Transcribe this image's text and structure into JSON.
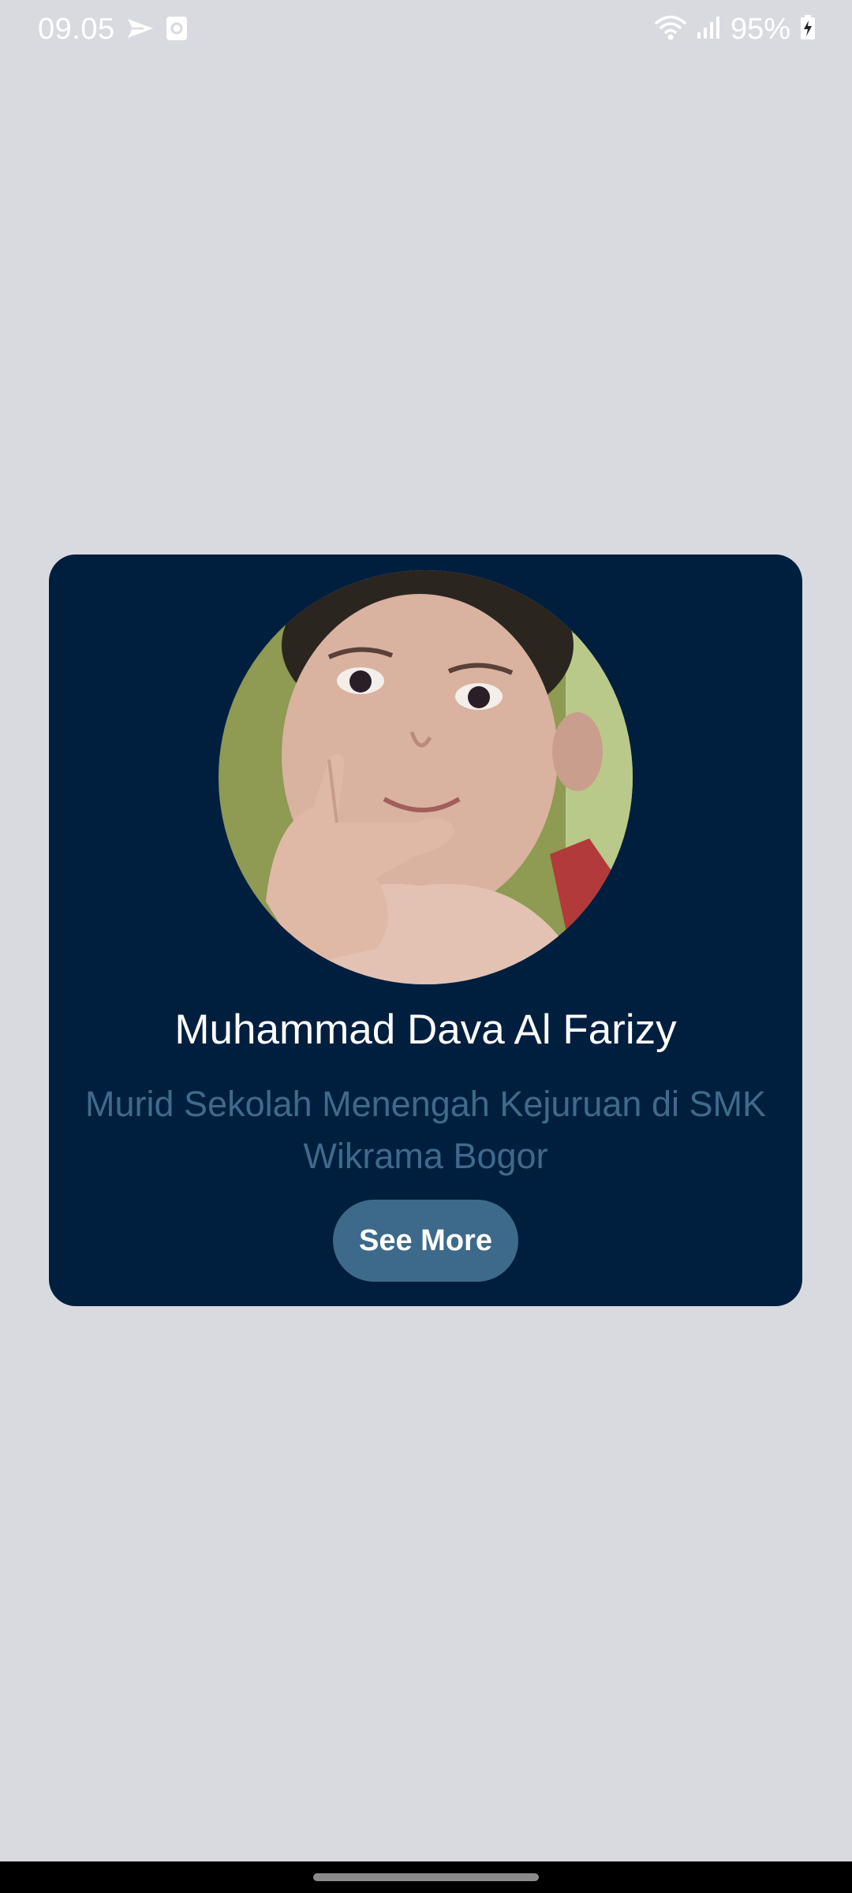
{
  "status_bar": {
    "time": "09.05",
    "battery": "95%",
    "icons": [
      "send-icon",
      "screen-record-icon",
      "wifi-icon",
      "signal-icon",
      "battery-charging-icon"
    ]
  },
  "profile": {
    "name": "Muhammad Dava Al Farizy",
    "description": "Murid Sekolah Menengah Kejuruan di SMK Wikrama Bogor",
    "button_label": "See More"
  },
  "colors": {
    "background": "#d9dae0",
    "card": "#001f3f",
    "accent": "#3d6a8a",
    "description_text": "#3f6a8c"
  }
}
